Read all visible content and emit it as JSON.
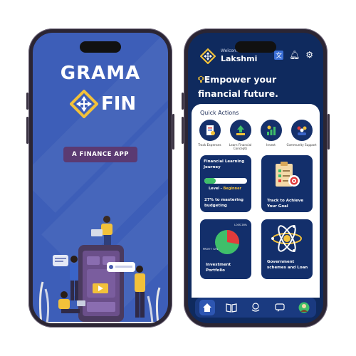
{
  "splash": {
    "brand_top": "GRAMA",
    "brand_bottom": "FIN",
    "tagline": "A FINANCE APP"
  },
  "home": {
    "welcome": "Welcome",
    "user_name": "Lakshmi",
    "headline": "Empower your financial future.",
    "quick_actions_title": "Quick Actions",
    "quick_actions": [
      {
        "label": "Track Expenses",
        "icon": "receipt-icon"
      },
      {
        "label": "Learn Financial Concepts",
        "icon": "money-growth-icon"
      },
      {
        "label": "Invest",
        "icon": "invest-chart-icon"
      },
      {
        "label": "Community Support",
        "icon": "community-icon"
      }
    ],
    "cards": {
      "learning_title": "Financial Learning Journey",
      "level_label": "Level - ",
      "level_value": "Beginner",
      "progress_percent": 27,
      "progress_text": "27% to mastering budgeting",
      "goal_label": "Track to Achieve Your Goal",
      "pie_loss": "LOSS 28%",
      "pie_profit": "PROFIT 72%",
      "portfolio_label": "Investment Portfolio",
      "schemes_label": "Government schemes and Loan"
    },
    "nav": [
      "home-icon",
      "book-icon",
      "rupee-hand-icon",
      "chat-help-icon",
      "profile-icon"
    ],
    "colors": {
      "navy": "#0f2a5e",
      "accent_yellow": "#f2c13a",
      "progress_green": "#3fbf6a",
      "pie_red": "#e23b3b"
    }
  }
}
